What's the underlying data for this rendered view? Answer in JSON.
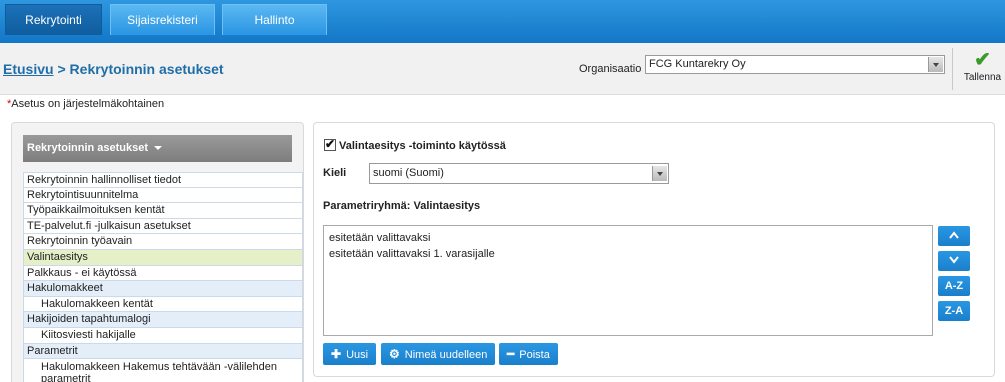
{
  "nav": {
    "tabs": [
      {
        "label": "Rekrytointi",
        "active": true
      },
      {
        "label": "Sijaisrekisteri",
        "active": false
      },
      {
        "label": "Hallinto",
        "active": false
      }
    ]
  },
  "header": {
    "breadcrumb_home": "Etusivu",
    "breadcrumb_sep": " > ",
    "breadcrumb_current": "Rekrytoinnin asetukset",
    "org_label": "Organisaatio",
    "org_value": "FCG Kuntarekry Oy",
    "save_label": "Tallenna"
  },
  "note": {
    "star": "*",
    "text": "Asetus on järjestelmäkohtainen"
  },
  "sidebar": {
    "title": "Rekrytoinnin asetukset",
    "items": [
      "Rekrytoinnin hallinnolliset tiedot",
      "Rekrytointisuunnitelma",
      "Työpaikkailmoituksen kentät",
      "TE-palvelut.fi -julkaisun asetukset",
      "Rekrytoinnin työavain",
      "Valintaesitys",
      "Palkkaus - ei käytössä",
      "Hakulomakkeet",
      "Hakulomakkeen kentät",
      "Hakijoiden tapahtumalogi",
      "Kiitosviesti hakijalle",
      "Parametrit",
      "Hakulomakkeen Hakemus tehtävään -välilehden parametrit"
    ]
  },
  "main": {
    "checkbox_label": "Valintaesitys -toiminto käytössä",
    "lang_label": "Kieli",
    "lang_value": "suomi (Suomi)",
    "param_title": "Parametriryhmä: Valintaesitys",
    "list_items": [
      "esitetään valittavaksi",
      "esitetään valittavaksi 1. varasijalle"
    ],
    "sort_az": "A-Z",
    "sort_za": "Z-A",
    "new_label": "Uusi",
    "rename_label": "Nimeä uudelleen",
    "delete_label": "Poista"
  },
  "colors": {
    "nav_bg": "#1a85d6",
    "accent_blue": "#1f88d8",
    "link": "#1f6ea8",
    "selected_row": "#e6f0c8",
    "save_check": "#3a9a2a"
  }
}
